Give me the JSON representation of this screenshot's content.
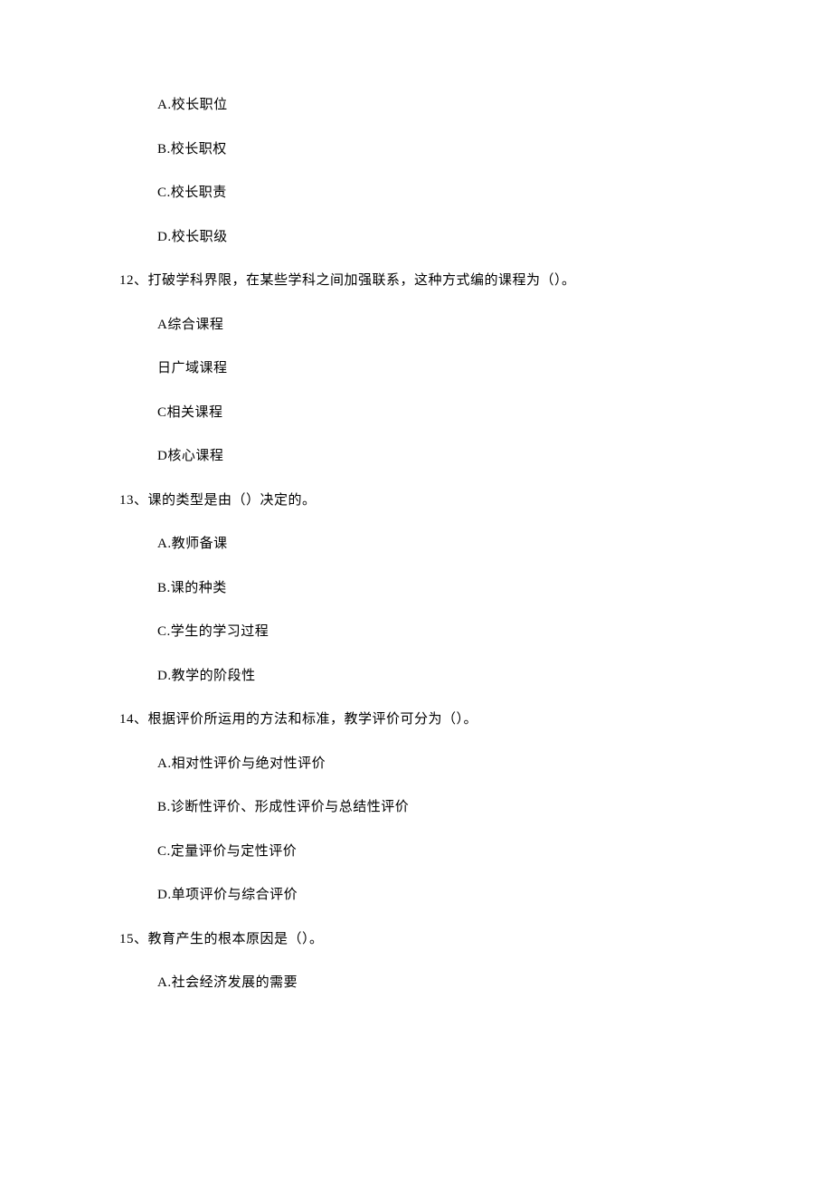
{
  "q11": {
    "options": [
      "A.校长职位",
      "B.校长职权",
      "C.校长职责",
      "D.校长职级"
    ]
  },
  "q12": {
    "stem": "12、打破学科界限，在某些学科之间加强联系，这种方式编的课程为（）。",
    "options": [
      "A综合课程",
      "日广域课程",
      "C相关课程",
      "D核心课程"
    ]
  },
  "q13": {
    "stem": "13、课的类型是由（）决定的。",
    "options": [
      "A.教师备课",
      "B.课的种类",
      "C.学生的学习过程",
      "D.教学的阶段性"
    ]
  },
  "q14": {
    "stem": "14、根据评价所运用的方法和标准，教学评价可分为（）。",
    "options": [
      "A.相对性评价与绝对性评价",
      "B.诊断性评价、形成性评价与总结性评价",
      "C.定量评价与定性评价",
      "D.单项评价与综合评价"
    ]
  },
  "q15": {
    "stem": "15、教育产生的根本原因是（）。",
    "options": [
      "A.社会经济发展的需要"
    ]
  }
}
